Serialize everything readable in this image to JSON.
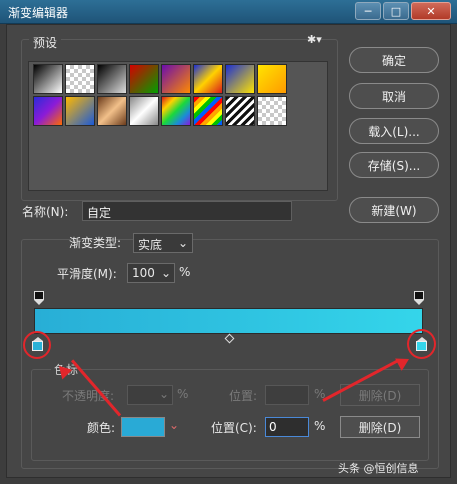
{
  "window": {
    "title": "渐变编辑器",
    "controls": [
      "─",
      "□",
      "✕"
    ]
  },
  "presets": {
    "label": "预设",
    "gear_glyph": "✱▾",
    "swatches": [
      "linear-gradient(135deg,#000,#fff)",
      "checker",
      "linear-gradient(135deg,#000,#ddd)",
      "linear-gradient(135deg,#d40000,#00a000)",
      "linear-gradient(135deg,#6a0dad,#ff8a00)",
      "linear-gradient(135deg,#1b2fd4,#ffd200,#d81b1b)",
      "linear-gradient(135deg,#1b2fd4,#ffe400)",
      "linear-gradient(135deg,#ffe400,#ff9a00)",
      "linear-gradient(135deg,#2b2bd8,#8b1bd8,#ff6b00)",
      "linear-gradient(135deg,#ffb800,#1b5ad8)",
      "linear-gradient(135deg,#6b3b1b,#f2c08a,#6b3b1b)",
      "linear-gradient(135deg,#888,#fff,#888)",
      "linear-gradient(135deg,#d81b1b,#ffd200,#1bd83b,#1b8bd8,#8b1bd8)",
      "repeating-linear-gradient(135deg,#ff0000 0 4px,#ffa500 4px 8px,#ffff00 8px 12px,#00c000 12px 16px,#0060ff 16px 20px)",
      "repeating-linear-gradient(135deg,#111 0 3px,#fff 3px 6px)",
      "checker"
    ]
  },
  "buttons": {
    "ok": "确定",
    "cancel": "取消",
    "load": "载入(L)...",
    "save": "存储(S)...",
    "new": "新建(W)"
  },
  "name": {
    "label": "名称(N):",
    "value": "自定"
  },
  "gradient": {
    "type_label": "渐变类型:",
    "type_value": "实底",
    "smooth_label": "平滑度(M):",
    "smooth_value": "100",
    "pct": "%",
    "start_color": "#28aed6",
    "end_color": "#34d5ea"
  },
  "stops": {
    "label": "色标",
    "opacity_label": "不透明度:",
    "opacity_pct": "%",
    "opacity_location_label": "位置:",
    "opacity_location_pct": "%",
    "opacity_delete": "删除(D)",
    "color_label": "颜色:",
    "color_value": "#29aad6",
    "color_location_label": "位置(C):",
    "color_location_value": "0",
    "color_location_pct": "%",
    "color_delete": "删除(D)"
  },
  "watermark": "头条 @恒创信息"
}
